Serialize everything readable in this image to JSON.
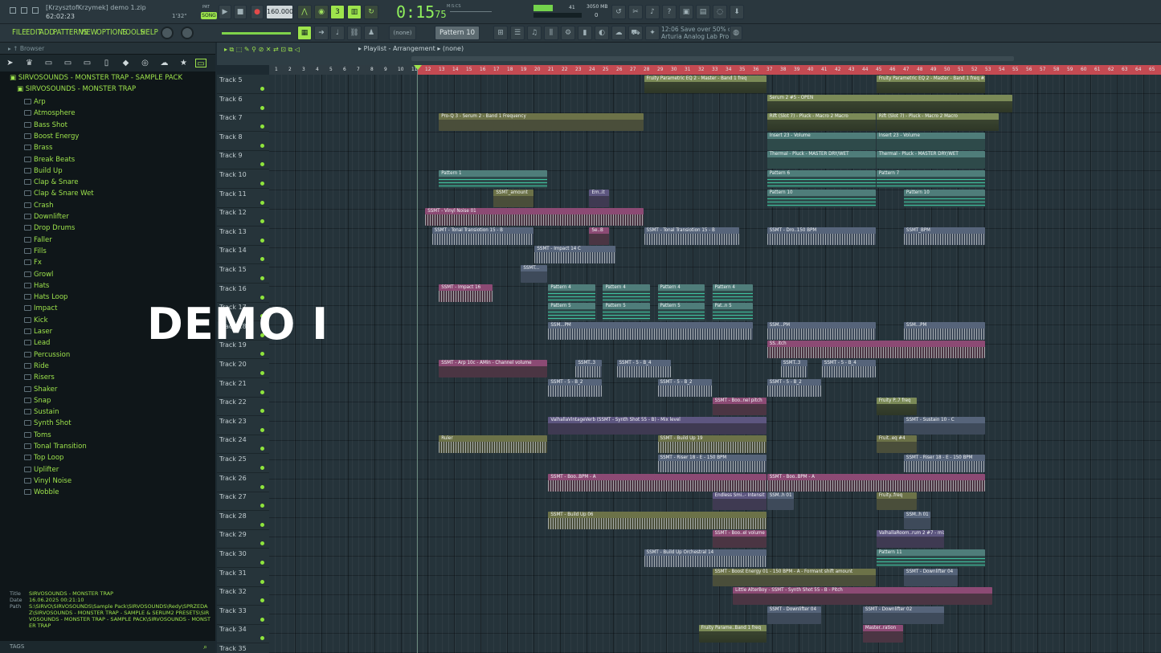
{
  "window": {
    "user_title": "[KrzysztofKrzymek] demo 1.zip",
    "clock": "62:02:23",
    "bar_pos": "1'32\"",
    "song_label": "SONG",
    "pat_label": "PAT"
  },
  "transport": {
    "tempo": "160.000",
    "time": "0:15",
    "time_sub": "75",
    "ms_cs": "M:S:CS",
    "cpu": "41",
    "memory": "3050 MB",
    "voices": "0"
  },
  "menu": [
    "FILE",
    "EDIT",
    "ADD",
    "PATTERNS",
    "VIEW",
    "OPTIONS",
    "TOOLS",
    "HELP"
  ],
  "toolbar": {
    "channel_select": "(none)",
    "pattern": "Pattern 10"
  },
  "hint": {
    "line1": "12:06  Save over 50% on",
    "line2": "Arturia Analog Lab Pro"
  },
  "browser": {
    "header": "Browser",
    "root": "SIRVOSOUNDS - MONSTER TRAP - SAMPLE PACK",
    "sub": "SIRVOSOUNDS - MONSTER TRAP",
    "folders": [
      "Arp",
      "Atmosphere",
      "Bass Shot",
      "Boost Energy",
      "Brass",
      "Break Beats",
      "Build Up",
      "Clap & Snare",
      "Clap & Snare Wet",
      "Crash",
      "Downlifter",
      "Drop Drums",
      "Faller",
      "Fills",
      "Fx",
      "Growl",
      "Hats",
      "Hats Loop",
      "Impact",
      "Kick",
      "Laser",
      "Lead",
      "Percussion",
      "Ride",
      "Risers",
      "Shaker",
      "Snap",
      "Sustain",
      "Synth Shot",
      "Toms",
      "Tonal Transition",
      "Top Loop",
      "Uplifter",
      "Vinyl Noise",
      "Wobble"
    ],
    "info": {
      "title_k": "Title",
      "title_v": "SIRVOSOUNDS - MONSTER TRAP",
      "date_k": "Date",
      "date_v": "16.06.2025 00:21:10",
      "path_k": "Path",
      "path_v": "S:\\SIRVO\\SIRVOSOUNDS\\Sample Pack\\SIRVOSOUNDS\\Redy\\SPRZEDAZ\\SIRVOSOUNDS - MONSTER TRAP - SAMPLE & SERUM2 PRESETS\\SIRVOSOUNDS - MONSTER TRAP - SAMPLE PACK\\SIRVOSOUNDS - MONSTER TRAP"
    },
    "tags_label": "TAGS"
  },
  "playlist": {
    "title": "Playlist - Arrangement",
    "title_sel": "(none)",
    "ruler": [
      "1",
      "2",
      "3",
      "4",
      "5",
      "6",
      "7",
      "8",
      "9",
      "10",
      "11",
      "12",
      "13",
      "14",
      "15",
      "16",
      "17",
      "18",
      "19",
      "20",
      "21",
      "22",
      "23",
      "24",
      "25",
      "26",
      "27",
      "28",
      "29",
      "30",
      "31",
      "32",
      "33",
      "34",
      "35",
      "36",
      "37",
      "38",
      "39",
      "40",
      "41",
      "42",
      "43",
      "44",
      "45",
      "46",
      "47",
      "48",
      "49",
      "50",
      "51",
      "52",
      "53",
      "54",
      "55",
      "56",
      "57",
      "58",
      "59",
      "60",
      "61",
      "62",
      "63",
      "64",
      "65"
    ],
    "tracks": [
      "Track 5",
      "Track 6",
      "Track 7",
      "Track 8",
      "Track 9",
      "Track 10",
      "Track 11",
      "Track 12",
      "Track 13",
      "Track 14",
      "Track 15",
      "Track 16",
      "Track 17",
      "Track 18",
      "Track 19",
      "Track 20",
      "Track 21",
      "Track 22",
      "Track 23",
      "Track 24",
      "Track 25",
      "Track 26",
      "Track 27",
      "Track 28",
      "Track 29",
      "Track 30",
      "Track 31",
      "Track 32",
      "Track 33",
      "Track 34",
      "Track 35"
    ],
    "clips": [
      {
        "t": 0,
        "b": 28,
        "e": 37,
        "c": "auto",
        "n": "Fruity Parametric EQ 2 - Master - Band 1 freq"
      },
      {
        "t": 0,
        "b": 45,
        "e": 53,
        "c": "auto",
        "n": "Fruity Parametric EQ 2 - Master - Band 1 freq #2"
      },
      {
        "t": 1,
        "b": 37,
        "e": 55,
        "c": "auto",
        "n": "Serum 2 #5 - OPEN"
      },
      {
        "t": 2,
        "b": 13,
        "e": 28,
        "c": "olive",
        "n": "Pro-Q 3 - Serum 2 - Band 1 Frequency"
      },
      {
        "t": 2,
        "b": 37,
        "e": 45,
        "c": "auto",
        "n": "Rift (Slot 7) - Pluck - Macro 2 Macro"
      },
      {
        "t": 2,
        "b": 45,
        "e": 54,
        "c": "auto",
        "n": "Rift (Slot 7) - Pluck - Macro 2 Macro"
      },
      {
        "t": 3,
        "b": 37,
        "e": 45,
        "c": "teal",
        "n": "Insert 23 - Volume"
      },
      {
        "t": 3,
        "b": 45,
        "e": 53,
        "c": "teal",
        "n": "Insert 23 - Volume"
      },
      {
        "t": 4,
        "b": 37,
        "e": 45,
        "c": "teal",
        "n": "Thermal - Pluck - MASTER DRY/WET"
      },
      {
        "t": 4,
        "b": 45,
        "e": 53,
        "c": "teal",
        "n": "Thermal - Pluck - MASTER DRY/WET"
      },
      {
        "t": 5,
        "b": 13,
        "e": 21,
        "c": "teal",
        "n": "Pattern 1",
        "notes": true
      },
      {
        "t": 5,
        "b": 37,
        "e": 45,
        "c": "teal",
        "n": "Pattern 6",
        "notes": true
      },
      {
        "t": 5,
        "b": 45,
        "e": 53,
        "c": "teal",
        "n": "Pattern 7",
        "notes": true
      },
      {
        "t": 6,
        "b": 17,
        "e": 20,
        "c": "olive",
        "n": "SSMT_amount"
      },
      {
        "t": 6,
        "b": 24,
        "e": 25.5,
        "c": "purple",
        "n": "Em..it"
      },
      {
        "t": 6,
        "b": 37,
        "e": 45,
        "c": "teal",
        "n": "Pattern 10",
        "notes": true
      },
      {
        "t": 6,
        "b": 47,
        "e": 53,
        "c": "teal",
        "n": "Pattern 10",
        "notes": true
      },
      {
        "t": 7,
        "b": 12,
        "e": 28,
        "c": "pink",
        "n": "SSMT - Vinyl Noise 01",
        "wav": true
      },
      {
        "t": 8,
        "b": 12.5,
        "e": 20,
        "c": "slate",
        "n": "SSMT - Tonal Transiotion 15 - B",
        "wav": true
      },
      {
        "t": 8,
        "b": 24,
        "e": 25.5,
        "c": "pink",
        "n": "Se..B"
      },
      {
        "t": 8,
        "b": 28,
        "e": 35,
        "c": "slate",
        "n": "SSMT - Tonal Transiotion 15 - B",
        "wav": true
      },
      {
        "t": 8,
        "b": 37,
        "e": 45,
        "c": "slate",
        "n": "SSMT - Dro..150 BPM",
        "wav": true
      },
      {
        "t": 8,
        "b": 47,
        "e": 53,
        "c": "slate",
        "n": "SSMT_BPM",
        "wav": true
      },
      {
        "t": 9,
        "b": 20,
        "e": 26,
        "c": "slate",
        "n": "SSMT - Impact 14 C",
        "wav": true
      },
      {
        "t": 10,
        "b": 19,
        "e": 21,
        "c": "slate",
        "n": "SSMT..."
      },
      {
        "t": 11,
        "b": 13,
        "e": 17,
        "c": "pink",
        "n": "SSMT - Impact 16",
        "wav": true
      },
      {
        "t": 11,
        "b": 21,
        "e": 24.5,
        "c": "teal",
        "n": "Pattern 4",
        "notes": true
      },
      {
        "t": 11,
        "b": 25,
        "e": 28.5,
        "c": "teal",
        "n": "Pattern 4",
        "notes": true
      },
      {
        "t": 11,
        "b": 29,
        "e": 32.5,
        "c": "teal",
        "n": "Pattern 4",
        "notes": true
      },
      {
        "t": 11,
        "b": 33,
        "e": 36,
        "c": "teal",
        "n": "Pattern 4",
        "notes": true
      },
      {
        "t": 12,
        "b": 21,
        "e": 24.5,
        "c": "teal",
        "n": "Pattern 5",
        "notes": true
      },
      {
        "t": 12,
        "b": 25,
        "e": 28.5,
        "c": "teal",
        "n": "Pattern 5",
        "notes": true
      },
      {
        "t": 12,
        "b": 29,
        "e": 32.5,
        "c": "teal",
        "n": "Pattern 5",
        "notes": true
      },
      {
        "t": 12,
        "b": 33,
        "e": 36,
        "c": "teal",
        "n": "Pat..n 5",
        "notes": true
      },
      {
        "t": 13,
        "b": 21,
        "e": 36,
        "c": "slate",
        "n": "SSM...PM",
        "wav": true
      },
      {
        "t": 13,
        "b": 37,
        "e": 45,
        "c": "slate",
        "n": "SSM...PM",
        "wav": true
      },
      {
        "t": 13,
        "b": 47,
        "e": 53,
        "c": "slate",
        "n": "SSM...PM",
        "wav": true
      },
      {
        "t": 14,
        "b": 37,
        "e": 53,
        "c": "pink",
        "n": "SS..itch",
        "wav": true
      },
      {
        "t": 15,
        "b": 13,
        "e": 21,
        "c": "pink",
        "n": "SSMT - Arp 10c - AMin - Channel volume"
      },
      {
        "t": 15,
        "b": 23,
        "e": 25,
        "c": "slate",
        "n": "SSMT..3",
        "wav": true
      },
      {
        "t": 15,
        "b": 26,
        "e": 30,
        "c": "slate",
        "n": "SSMT - 5 - B_4",
        "wav": true
      },
      {
        "t": 15,
        "b": 38,
        "e": 40,
        "c": "slate",
        "n": "SSMT..3",
        "wav": true
      },
      {
        "t": 15,
        "b": 41,
        "e": 45,
        "c": "slate",
        "n": "SSMT - 5 - B_4",
        "wav": true
      },
      {
        "t": 16,
        "b": 21,
        "e": 25,
        "c": "slate",
        "n": "SSMT - 5 - B_2",
        "wav": true
      },
      {
        "t": 16,
        "b": 29,
        "e": 33,
        "c": "slate",
        "n": "SSMT - 5 - B_2",
        "wav": true
      },
      {
        "t": 16,
        "b": 37,
        "e": 41,
        "c": "slate",
        "n": "SSMT - 5 - B_2",
        "wav": true
      },
      {
        "t": 17,
        "b": 33,
        "e": 37,
        "c": "pink",
        "n": "SSMT - Boo..nel pitch"
      },
      {
        "t": 17,
        "b": 45,
        "e": 48,
        "c": "auto",
        "n": "Fruity P..7 freq"
      },
      {
        "t": 18,
        "b": 21,
        "e": 37,
        "c": "purple",
        "n": "ValhallaVintageVerb (SSMT - Synth Shot 55 - B) - Mix level"
      },
      {
        "t": 18,
        "b": 47,
        "e": 53,
        "c": "slate",
        "n": "SSMT - Sustain 10 - C"
      },
      {
        "t": 19,
        "b": 13,
        "e": 21,
        "c": "olive",
        "n": "Ruler",
        "wav": true
      },
      {
        "t": 19,
        "b": 29,
        "e": 37,
        "c": "olive",
        "n": "SSMT - Build Up 19",
        "wav": true
      },
      {
        "t": 19,
        "b": 45,
        "e": 48,
        "c": "olive",
        "n": "Fruit..eq #4"
      },
      {
        "t": 20,
        "b": 29,
        "e": 37,
        "c": "slate",
        "n": "SSMT - Riser 18 - E - 150 BPM",
        "wav": true
      },
      {
        "t": 20,
        "b": 47,
        "e": 53,
        "c": "slate",
        "n": "SSMT - Riser 18 - E - 150 BPM",
        "wav": true
      },
      {
        "t": 21,
        "b": 21,
        "e": 37,
        "c": "pink",
        "n": "SSMT - Boo..BPM - A",
        "wav": true
      },
      {
        "t": 21,
        "b": 37,
        "e": 53,
        "c": "pink",
        "n": "SSMT - Boo..BPM - A",
        "wav": true
      },
      {
        "t": 22,
        "b": 33,
        "e": 37,
        "c": "purple",
        "n": "Endless Smi..- Intensit"
      },
      {
        "t": 22,
        "b": 37,
        "e": 39,
        "c": "slate",
        "n": "SSM..h 01"
      },
      {
        "t": 22,
        "b": 45,
        "e": 48,
        "c": "olive",
        "n": "Fruity..freq"
      },
      {
        "t": 23,
        "b": 21,
        "e": 37,
        "c": "olive",
        "n": "SSMT - Build Up 06",
        "wav": true
      },
      {
        "t": 23,
        "b": 47,
        "e": 49,
        "c": "slate",
        "n": "SSM..h 01"
      },
      {
        "t": 24,
        "b": 33,
        "e": 37,
        "c": "pink",
        "n": "SSMT - Boo..el volume"
      },
      {
        "t": 24,
        "b": 45,
        "e": 50,
        "c": "purple",
        "n": "ValhallaRoom..rum 2 #7 - mix"
      },
      {
        "t": 25,
        "b": 28,
        "e": 37,
        "c": "slate",
        "n": "SSMT - Build Up Orchestral 14",
        "wav": true
      },
      {
        "t": 25,
        "b": 45,
        "e": 53,
        "c": "teal",
        "n": "Pattern 11",
        "notes": true
      },
      {
        "t": 26,
        "b": 33,
        "e": 45,
        "c": "olive",
        "n": "SSMT - Boost Energy 01 - 150 BPM - A - Formant shift amount"
      },
      {
        "t": 26,
        "b": 47,
        "e": 51,
        "c": "slate",
        "n": "SSMT - Downlifter 04"
      },
      {
        "t": 27,
        "b": 34.5,
        "e": 53.5,
        "c": "pink",
        "n": "Little AlterBoy - SSMT - Synth Shot 55 - B - Pitch"
      },
      {
        "t": 28,
        "b": 37,
        "e": 41,
        "c": "slate",
        "n": "SSMT - Downlifter 04"
      },
      {
        "t": 28,
        "b": 44,
        "e": 50,
        "c": "slate",
        "n": "SSMT - Downlifter 02"
      },
      {
        "t": 29,
        "b": 32,
        "e": 37,
        "c": "auto",
        "n": "Fruity Parame..Band 1 freq"
      },
      {
        "t": 29,
        "b": 44,
        "e": 47,
        "c": "pink",
        "n": "Master..ration"
      }
    ]
  },
  "overlay": {
    "demo": "DEMO I"
  },
  "colors": {
    "accent": "#9ee44c",
    "ruler_highlight": "#c44a52",
    "bg": "#1d2a31"
  }
}
